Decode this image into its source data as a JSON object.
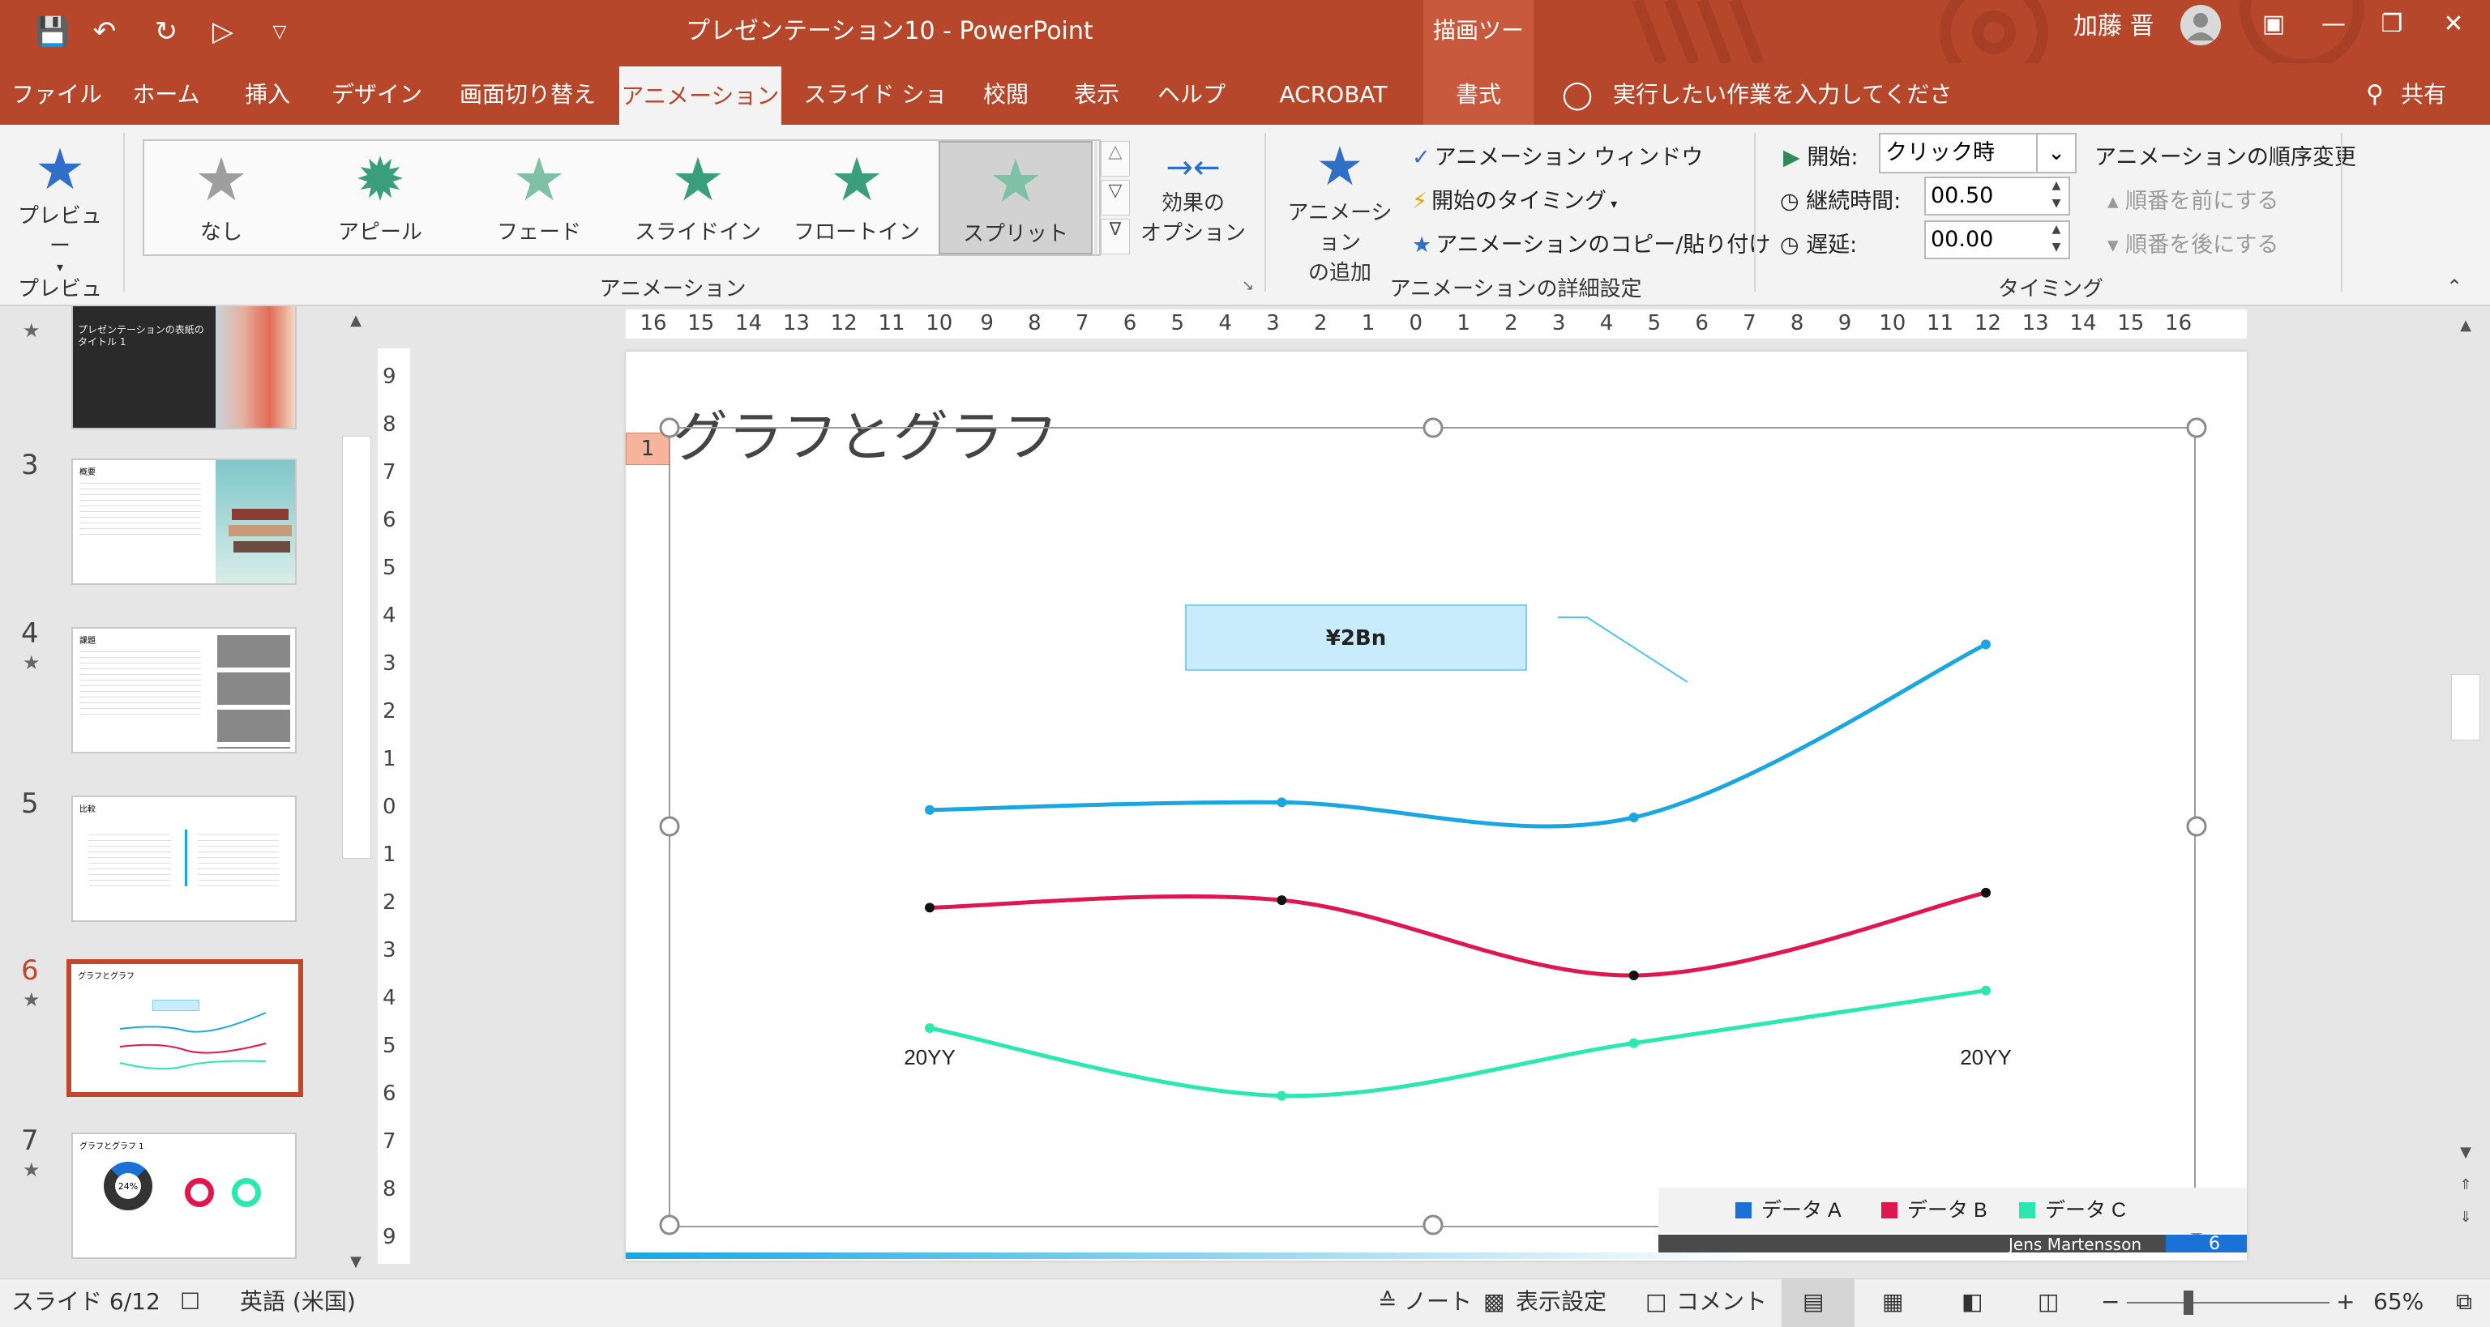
{
  "titlebar": {
    "doc_title": "プレゼンテーション10  -  PowerPoint",
    "context_tool": "描画ツール",
    "user_name": "加藤 晋",
    "share": "共有"
  },
  "tabs": [
    {
      "label": "ファイル"
    },
    {
      "label": "ホーム"
    },
    {
      "label": "挿入"
    },
    {
      "label": "デザイン"
    },
    {
      "label": "画面切り替え"
    },
    {
      "label": "アニメーション"
    },
    {
      "label": "スライド ショー"
    },
    {
      "label": "校閲"
    },
    {
      "label": "表示"
    },
    {
      "label": "ヘルプ"
    },
    {
      "label": "ACROBAT"
    },
    {
      "label": "書式"
    }
  ],
  "tell_me": "実行したい作業を入力してください",
  "ribbon": {
    "preview": {
      "label": "プレビュー",
      "group": "プレビュー"
    },
    "animation_group": "アニメーション",
    "gallery": [
      {
        "label": "なし",
        "color": "#9e9e9e"
      },
      {
        "label": "アピール",
        "color": "#3a9e7d"
      },
      {
        "label": "フェード",
        "color": "#7fc1a7"
      },
      {
        "label": "スライドイン",
        "color": "#3a9e7d"
      },
      {
        "label": "フロートイン",
        "color": "#3a9e7d"
      },
      {
        "label": "スプリット",
        "color": "#7fc1a7"
      }
    ],
    "effect_options": {
      "line1": "効果の",
      "line2": "オプション"
    },
    "add_animation": {
      "line1": "アニメーション",
      "line2": "の追加"
    },
    "advanced": {
      "animation_window": "アニメーション ウィンドウ",
      "trigger": "開始のタイミング",
      "painter": "アニメーションのコピー/貼り付け",
      "group": "アニメーションの詳細設定"
    },
    "timing": {
      "start_label": "開始:",
      "start_value": "クリック時",
      "duration_label": "継続時間:",
      "duration_value": "00.50",
      "delay_label": "遅延:",
      "delay_value": "00.00",
      "reorder": "アニメーションの順序変更",
      "move_earlier": "順番を前にする",
      "move_later": "順番を後にする",
      "group": "タイミング"
    }
  },
  "thumbs": [
    {
      "num": "",
      "title": "プレゼンテーションの表紙のタイトル 1"
    },
    {
      "num": "3",
      "title": "概要"
    },
    {
      "num": "4",
      "title": "課題"
    },
    {
      "num": "5",
      "title": "比較"
    },
    {
      "num": "6",
      "title": "グラフとグラフ"
    },
    {
      "num": "7",
      "title": "グラフとグラフ 1",
      "donut_pct": "24%"
    }
  ],
  "ruler_h": [
    "16",
    "15",
    "14",
    "13",
    "12",
    "11",
    "10",
    "9",
    "8",
    "7",
    "6",
    "5",
    "4",
    "3",
    "2",
    "1",
    "0",
    "1",
    "2",
    "3",
    "4",
    "5",
    "6",
    "7",
    "8",
    "9",
    "10",
    "11",
    "12",
    "13",
    "14",
    "15",
    "16"
  ],
  "ruler_v": [
    "9",
    "8",
    "7",
    "6",
    "5",
    "4",
    "3",
    "2",
    "1",
    "0",
    "1",
    "2",
    "3",
    "4",
    "5",
    "6",
    "7",
    "8",
    "9"
  ],
  "slide": {
    "title": "グラフとグラフ",
    "anim_tag": "1",
    "callout": "¥2Bn",
    "footer_name": "Jens Martensson",
    "page_num": "6"
  },
  "chart_data": {
    "type": "line",
    "x": [
      "20YY",
      "",
      "",
      "20YY"
    ],
    "series": [
      {
        "name": "データ A",
        "color": "#1aa7e0",
        "values": [
          4.1,
          4.15,
          4.05,
          5.2
        ]
      },
      {
        "name": "データ B",
        "color": "#e0174f",
        "values": [
          3.45,
          3.5,
          3.0,
          3.55
        ]
      },
      {
        "name": "データ C",
        "color": "#2ae8b0",
        "values": [
          2.65,
          2.2,
          2.55,
          2.9
        ]
      }
    ],
    "ylim": [
      1.6,
      5.8
    ],
    "legend": "bottom-right"
  },
  "status": {
    "slide": "スライド 6/12",
    "lang": "英語 (米国)",
    "notes": "ノート",
    "display": "表示設定",
    "comments": "コメント",
    "zoom": "65%"
  },
  "colors": {
    "accent": "#b7472a",
    "ribbon": "#f3f3f3"
  }
}
